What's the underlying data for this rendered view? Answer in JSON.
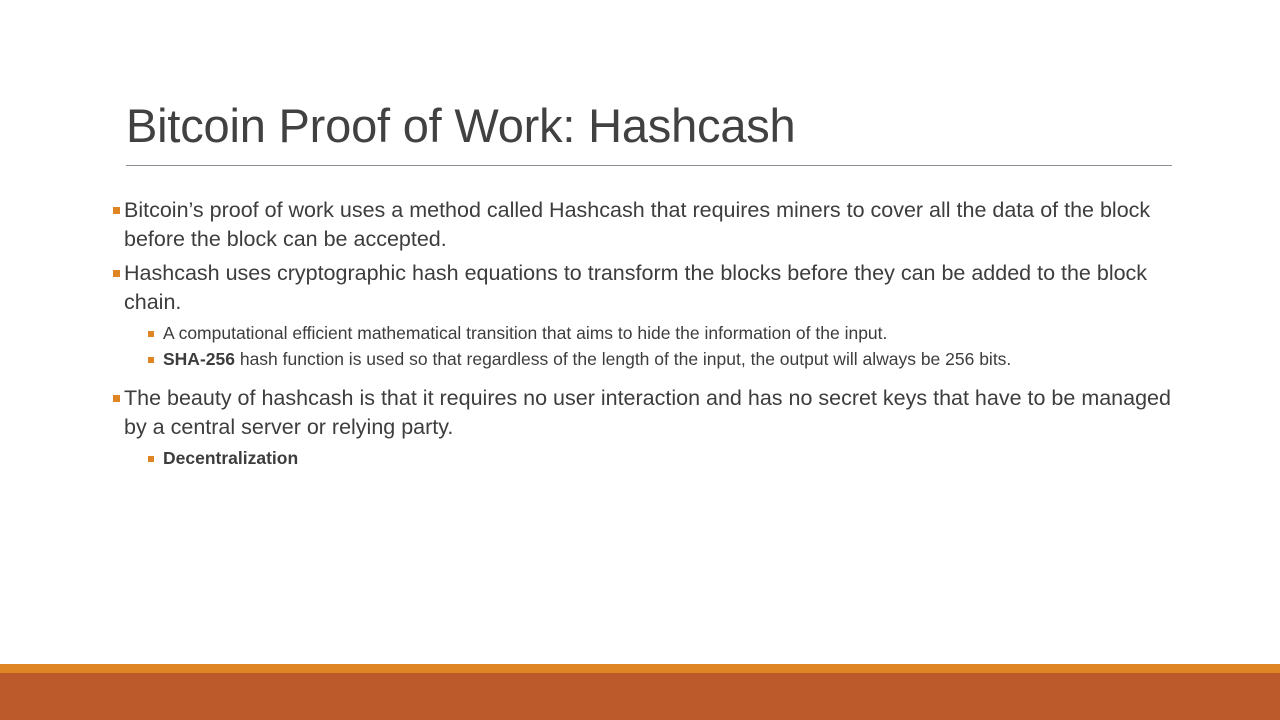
{
  "slide": {
    "title": "Bitcoin Proof of Work: Hashcash",
    "bullets": [
      {
        "level": 1,
        "text": "Bitcoin’s proof of work uses a method called Hashcash that requires miners to cover all the data of the block before the block can be accepted."
      },
      {
        "level": 1,
        "text": "Hashcash uses cryptographic hash equations to transform the blocks before they can be added to the block chain."
      },
      {
        "level": 2,
        "text": "A computational efficient mathematical transition that aims to hide the information of the input."
      },
      {
        "level": 2,
        "bold_prefix": "SHA-256",
        "text": " hash function is used so that regardless of the length of the input, the output will always be 256 bits."
      },
      {
        "level": 1,
        "text": "The beauty of hashcash is that it requires no user interaction and has no secret keys that have to be managed by a central server or relying party."
      },
      {
        "level": 2,
        "bold_prefix": "Decentralization",
        "text": ""
      }
    ]
  },
  "colors": {
    "accent_orange": "#E08524",
    "footer_terracotta": "#BC5A2B",
    "title_text": "#414141",
    "body_text": "#3d3d3d",
    "rule": "#8d8d95"
  }
}
